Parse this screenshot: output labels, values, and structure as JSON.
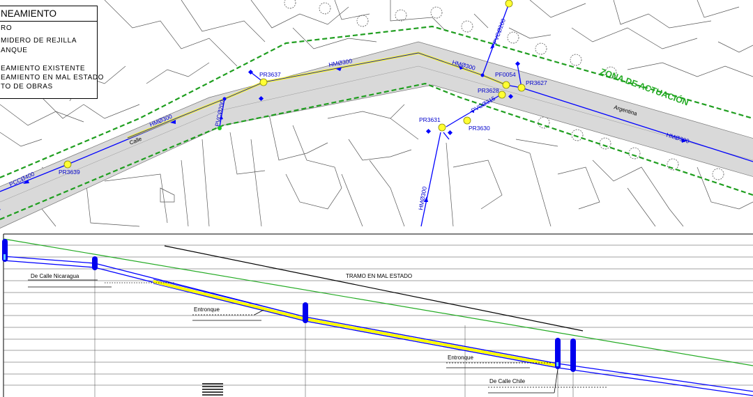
{
  "legend": {
    "title": "NEAMIENTO",
    "items": [
      "RO",
      "MIDERO DE REJILLA",
      "ANQUE",
      "EAMIENTO EXISTENTE",
      "EAMIENTO EN MAL ESTADO",
      "TO DE OBRAS"
    ]
  },
  "plan": {
    "zone_label": "ZONA DE ACTUACIÓN",
    "street_calle": "Calle",
    "street_argentina": "Argentina",
    "pipes": {
      "hm300_a": "HMØ300",
      "hm300_b": "HMØ300",
      "hm300_c": "HMØ300",
      "hm300_d": "HMØ300",
      "hm300_e": "HMØ300",
      "pvc200_a": "PVCØ200",
      "pvc200_b": "PVCØ200",
      "pvc315": "PVCØ315",
      "pcc400": "PCCØ400"
    },
    "manholes": {
      "pr3637": "PR3637",
      "pr3639": "PR3639",
      "pf0054": "PF0054",
      "pr3628": "PR3628",
      "pr3627": "PR3627",
      "pr3631": "PR3631",
      "pr3630": "PR3630"
    }
  },
  "profile": {
    "tramo_label": "TRAMO EN MAL ESTADO",
    "label_nicaragua": "De Calle Nicaragua",
    "label_entronque_1": "Entronque",
    "label_entronque_2": "Entronque",
    "label_chile": "De Calle Chile"
  },
  "colors": {
    "zone_border": "#1f9e1f",
    "pipe_blue": "#0000ff",
    "bad_state": "#ffff00",
    "road_fill": "#d9d9d9"
  }
}
